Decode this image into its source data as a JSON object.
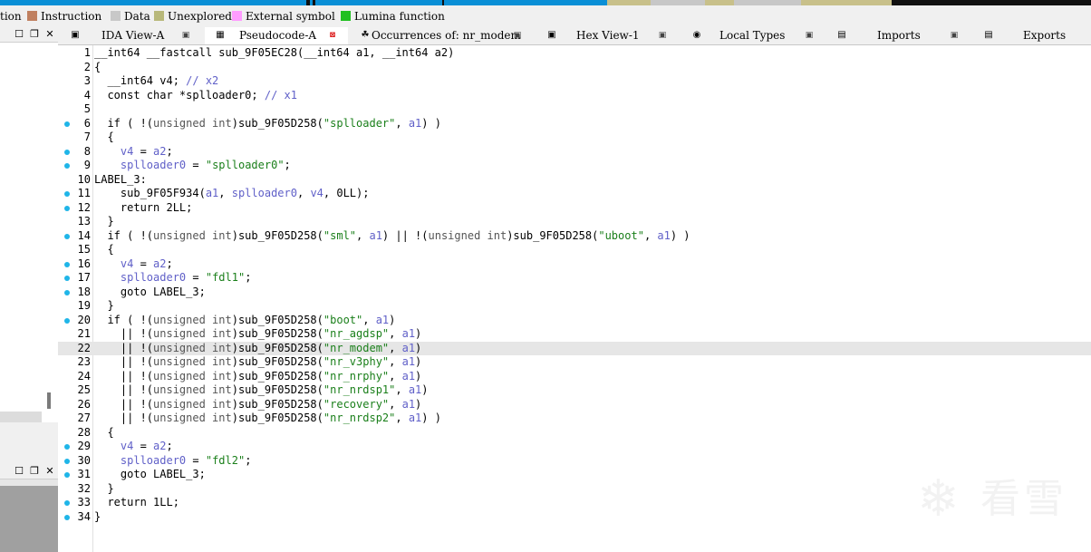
{
  "navband": {
    "colors": {
      "code": "#0a8fd6",
      "data": "#c7c7c7",
      "unexplored": "#c8c08a",
      "dark": "#111111"
    }
  },
  "legend": {
    "items": [
      {
        "label": "tion",
        "color": ""
      },
      {
        "label": "Instruction",
        "color": "#c08060"
      },
      {
        "label": "Data",
        "color": "#c8c8c8"
      },
      {
        "label": "Unexplored",
        "color": "#b8b87a"
      },
      {
        "label": "External symbol",
        "color": "#ff9cff"
      },
      {
        "label": "Lumina function",
        "color": "#20c020"
      }
    ]
  },
  "left_panels": {
    "top_buttons": [
      "☐",
      "❐",
      "✕"
    ],
    "bottom_buttons": [
      "☐",
      "❐",
      "✕"
    ]
  },
  "tabs": [
    {
      "label": "IDA View-A",
      "icon": "ida-view-icon",
      "active": false
    },
    {
      "label": "Pseudocode-A",
      "icon": "pseudocode-icon",
      "active": true
    },
    {
      "label": "Occurrences of: nr_modem",
      "icon": "occurrences-icon",
      "active": false
    },
    {
      "label": "Hex View-1",
      "icon": "hex-view-icon",
      "active": false
    },
    {
      "label": "Local Types",
      "icon": "local-types-icon",
      "active": false
    },
    {
      "label": "Imports",
      "icon": "imports-icon",
      "active": false
    },
    {
      "label": "Exports",
      "icon": "exports-icon",
      "active": false
    }
  ],
  "code": {
    "lines": [
      {
        "n": "1",
        "bp": false,
        "t": [
          [
            "",
            "__int64 __fastcall sub_9F05EC28(__int64 a1, __int64 a2)"
          ]
        ]
      },
      {
        "n": "2",
        "bp": false,
        "t": [
          [
            "",
            "{"
          ]
        ]
      },
      {
        "n": "3",
        "bp": false,
        "t": [
          [
            "",
            "  __int64 v4; "
          ],
          [
            "cmt",
            "// x2"
          ]
        ]
      },
      {
        "n": "4",
        "bp": false,
        "t": [
          [
            "",
            "  const char *splloader0; "
          ],
          [
            "cmt",
            "// x1"
          ]
        ]
      },
      {
        "n": "5",
        "bp": false,
        "t": [
          [
            "",
            ""
          ]
        ]
      },
      {
        "n": "6",
        "bp": true,
        "t": [
          [
            "",
            "  if ( !("
          ],
          [
            "gray",
            "unsigned int"
          ],
          [
            "",
            ")sub_9F05D258("
          ],
          [
            "str",
            "\"splloader\""
          ],
          [
            "",
            ", "
          ],
          [
            "var",
            "a1"
          ],
          [
            "",
            ") )"
          ]
        ]
      },
      {
        "n": "7",
        "bp": false,
        "t": [
          [
            "",
            "  {"
          ]
        ]
      },
      {
        "n": "8",
        "bp": true,
        "t": [
          [
            "",
            "    "
          ],
          [
            "var",
            "v4"
          ],
          [
            "",
            " = "
          ],
          [
            "var",
            "a2"
          ],
          [
            "",
            ";"
          ]
        ]
      },
      {
        "n": "9",
        "bp": true,
        "t": [
          [
            "",
            "    "
          ],
          [
            "var",
            "splloader0"
          ],
          [
            "",
            " = "
          ],
          [
            "str",
            "\"splloader0\""
          ],
          [
            "",
            ";"
          ]
        ]
      },
      {
        "n": "10",
        "bp": false,
        "t": [
          [
            "",
            "LABEL_3:"
          ]
        ]
      },
      {
        "n": "11",
        "bp": true,
        "t": [
          [
            "",
            "    sub_9F05F934("
          ],
          [
            "var",
            "a1"
          ],
          [
            "",
            ", "
          ],
          [
            "var",
            "splloader0"
          ],
          [
            "",
            ", "
          ],
          [
            "var",
            "v4"
          ],
          [
            "",
            ", 0LL);"
          ]
        ]
      },
      {
        "n": "12",
        "bp": true,
        "t": [
          [
            "",
            "    return 2LL;"
          ]
        ]
      },
      {
        "n": "13",
        "bp": false,
        "t": [
          [
            "",
            "  }"
          ]
        ]
      },
      {
        "n": "14",
        "bp": true,
        "t": [
          [
            "",
            "  if ( !("
          ],
          [
            "gray",
            "unsigned int"
          ],
          [
            "",
            ")sub_9F05D258("
          ],
          [
            "str",
            "\"sml\""
          ],
          [
            "",
            ", "
          ],
          [
            "var",
            "a1"
          ],
          [
            "",
            ") || !("
          ],
          [
            "gray",
            "unsigned int"
          ],
          [
            "",
            ")sub_9F05D258("
          ],
          [
            "str",
            "\"uboot\""
          ],
          [
            "",
            ", "
          ],
          [
            "var",
            "a1"
          ],
          [
            "",
            ") )"
          ]
        ]
      },
      {
        "n": "15",
        "bp": false,
        "t": [
          [
            "",
            "  {"
          ]
        ]
      },
      {
        "n": "16",
        "bp": true,
        "t": [
          [
            "",
            "    "
          ],
          [
            "var",
            "v4"
          ],
          [
            "",
            " = "
          ],
          [
            "var",
            "a2"
          ],
          [
            "",
            ";"
          ]
        ]
      },
      {
        "n": "17",
        "bp": true,
        "t": [
          [
            "",
            "    "
          ],
          [
            "var",
            "splloader0"
          ],
          [
            "",
            " = "
          ],
          [
            "str",
            "\"fdl1\""
          ],
          [
            "",
            ";"
          ]
        ]
      },
      {
        "n": "18",
        "bp": true,
        "t": [
          [
            "",
            "    goto LABEL_3;"
          ]
        ]
      },
      {
        "n": "19",
        "bp": false,
        "t": [
          [
            "",
            "  }"
          ]
        ]
      },
      {
        "n": "20",
        "bp": true,
        "t": [
          [
            "",
            "  if ( !("
          ],
          [
            "gray",
            "unsigned int"
          ],
          [
            "",
            ")sub_9F05D258("
          ],
          [
            "str",
            "\"boot\""
          ],
          [
            "",
            ", "
          ],
          [
            "var",
            "a1"
          ],
          [
            "",
            ")"
          ]
        ]
      },
      {
        "n": "21",
        "bp": false,
        "t": [
          [
            "",
            "    || !("
          ],
          [
            "gray",
            "unsigned int"
          ],
          [
            "",
            ")sub_9F05D258("
          ],
          [
            "str",
            "\"nr_agdsp\""
          ],
          [
            "",
            ", "
          ],
          [
            "var",
            "a1"
          ],
          [
            "",
            ")"
          ]
        ]
      },
      {
        "n": "22",
        "bp": false,
        "hl": true,
        "t": [
          [
            "",
            "    || !("
          ],
          [
            "gray",
            "unsigned int"
          ],
          [
            "",
            ")sub_9F05D258("
          ],
          [
            "str",
            "\"nr_modem\""
          ],
          [
            "",
            ", "
          ],
          [
            "var",
            "a1"
          ],
          [
            "",
            ")"
          ]
        ]
      },
      {
        "n": "23",
        "bp": false,
        "t": [
          [
            "",
            "    || !("
          ],
          [
            "gray",
            "unsigned int"
          ],
          [
            "",
            ")sub_9F05D258("
          ],
          [
            "str",
            "\"nr_v3phy\""
          ],
          [
            "",
            ", "
          ],
          [
            "var",
            "a1"
          ],
          [
            "",
            ")"
          ]
        ]
      },
      {
        "n": "24",
        "bp": false,
        "t": [
          [
            "",
            "    || !("
          ],
          [
            "gray",
            "unsigned int"
          ],
          [
            "",
            ")sub_9F05D258("
          ],
          [
            "str",
            "\"nr_nrphy\""
          ],
          [
            "",
            ", "
          ],
          [
            "var",
            "a1"
          ],
          [
            "",
            ")"
          ]
        ]
      },
      {
        "n": "25",
        "bp": false,
        "t": [
          [
            "",
            "    || !("
          ],
          [
            "gray",
            "unsigned int"
          ],
          [
            "",
            ")sub_9F05D258("
          ],
          [
            "str",
            "\"nr_nrdsp1\""
          ],
          [
            "",
            ", "
          ],
          [
            "var",
            "a1"
          ],
          [
            "",
            ")"
          ]
        ]
      },
      {
        "n": "26",
        "bp": false,
        "t": [
          [
            "",
            "    || !("
          ],
          [
            "gray",
            "unsigned int"
          ],
          [
            "",
            ")sub_9F05D258("
          ],
          [
            "str",
            "\"recovery\""
          ],
          [
            "",
            ", "
          ],
          [
            "var",
            "a1"
          ],
          [
            "",
            ")"
          ]
        ]
      },
      {
        "n": "27",
        "bp": false,
        "t": [
          [
            "",
            "    || !("
          ],
          [
            "gray",
            "unsigned int"
          ],
          [
            "",
            ")sub_9F05D258("
          ],
          [
            "str",
            "\"nr_nrdsp2\""
          ],
          [
            "",
            ", "
          ],
          [
            "var",
            "a1"
          ],
          [
            "",
            ") )"
          ]
        ]
      },
      {
        "n": "28",
        "bp": false,
        "t": [
          [
            "",
            "  {"
          ]
        ]
      },
      {
        "n": "29",
        "bp": true,
        "t": [
          [
            "",
            "    "
          ],
          [
            "var",
            "v4"
          ],
          [
            "",
            " = "
          ],
          [
            "var",
            "a2"
          ],
          [
            "",
            ";"
          ]
        ]
      },
      {
        "n": "30",
        "bp": true,
        "t": [
          [
            "",
            "    "
          ],
          [
            "var",
            "splloader0"
          ],
          [
            "",
            " = "
          ],
          [
            "str",
            "\"fdl2\""
          ],
          [
            "",
            ";"
          ]
        ]
      },
      {
        "n": "31",
        "bp": true,
        "t": [
          [
            "",
            "    goto LABEL_3;"
          ]
        ]
      },
      {
        "n": "32",
        "bp": false,
        "t": [
          [
            "",
            "  }"
          ]
        ]
      },
      {
        "n": "33",
        "bp": true,
        "t": [
          [
            "",
            "  return 1LL;"
          ]
        ]
      },
      {
        "n": "34",
        "bp": true,
        "t": [
          [
            "",
            "}"
          ]
        ]
      }
    ]
  },
  "watermark": {
    "icon": "snowflake-logo",
    "text": "看雪"
  }
}
